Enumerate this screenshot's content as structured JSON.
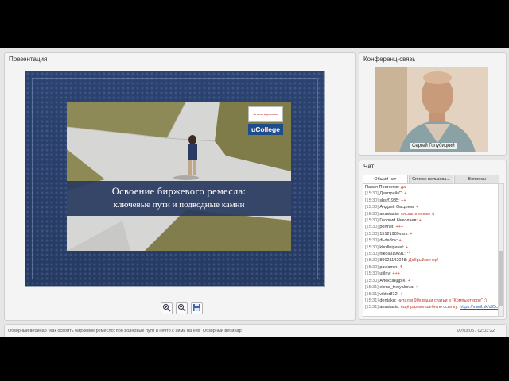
{
  "presentation": {
    "title": "Презентация",
    "slide": {
      "headline_line1": "Освоение биржевого ремесла:",
      "headline_line2": "ключевые пути и подводные камни",
      "logo_top": "Инвестиционная группа",
      "logo_bottom": "uCollege"
    },
    "toolbar": {
      "zoom_in_icon": "zoom-in-icon",
      "zoom_out_icon": "zoom-out-icon",
      "save_icon": "save-icon"
    }
  },
  "conference": {
    "title": "Конференц-связь",
    "speaker_name": "Сергей Голубицкий"
  },
  "chat": {
    "title": "Чат",
    "tabs": [
      "Общий чат",
      "Список пользова...",
      "Вопросы"
    ],
    "messages": [
      {
        "time": "",
        "user": "Павел Постелов:",
        "text": "да"
      },
      {
        "time": "[15:30]",
        "user": "Дмитрий С:",
        "text": "+"
      },
      {
        "time": "[15:30]",
        "user": "sbsff1985:",
        "text": "++"
      },
      {
        "time": "[15:30]",
        "user": "Андрей Овсдяев:",
        "text": "+"
      },
      {
        "time": "[15:30]",
        "user": "anastasia:",
        "text": "слышно екоже :)"
      },
      {
        "time": "[15:30]",
        "user": "Георгий Николаев:",
        "text": "+"
      },
      {
        "time": "[15:30]",
        "user": "portnet:",
        "text": "+++"
      },
      {
        "time": "[15:30]",
        "user": "15121989vars:",
        "text": "+"
      },
      {
        "time": "[15:30]",
        "user": "di-dedov:",
        "text": "+"
      },
      {
        "time": "[15:30]",
        "user": "khrdlnipavel:",
        "text": "+"
      },
      {
        "time": "[15:30]",
        "user": "nikolai19691:",
        "text": "**"
      },
      {
        "time": "[15:30]",
        "user": "89021142048:",
        "text": "Добрый вечер!"
      },
      {
        "time": "[15:30]",
        "user": "pavlamin:",
        "text": "4"
      },
      {
        "time": "[15:30]",
        "user": "ufilnv:",
        "text": "+++"
      },
      {
        "time": "[15:30]",
        "user": "Александр К:",
        "text": "+"
      },
      {
        "time": "[15:31]",
        "user": "elena_tretyakova:",
        "text": "+"
      },
      {
        "time": "[15:31]",
        "user": "viktor812:",
        "text": "+"
      },
      {
        "time": "[15:31]",
        "user": "dentaku:",
        "text": "читал в 90х ваши статьи в \"Компьютерре\" :)"
      },
      {
        "time": "[15:31]",
        "user": "anastasia:",
        "text": "ещё раз волшебную ссылку:",
        "link": "https://vaeil.sk/d/Dc-7ZD2s/k66ocT"
      }
    ]
  },
  "status_bar": {
    "title": "Обзорный вебинар \"Как освоить биржевое ремесло: про волновые пути и нечто с ними на них\" Обзорный вебинар",
    "time": "00:03:05 / 02:03:22"
  }
}
